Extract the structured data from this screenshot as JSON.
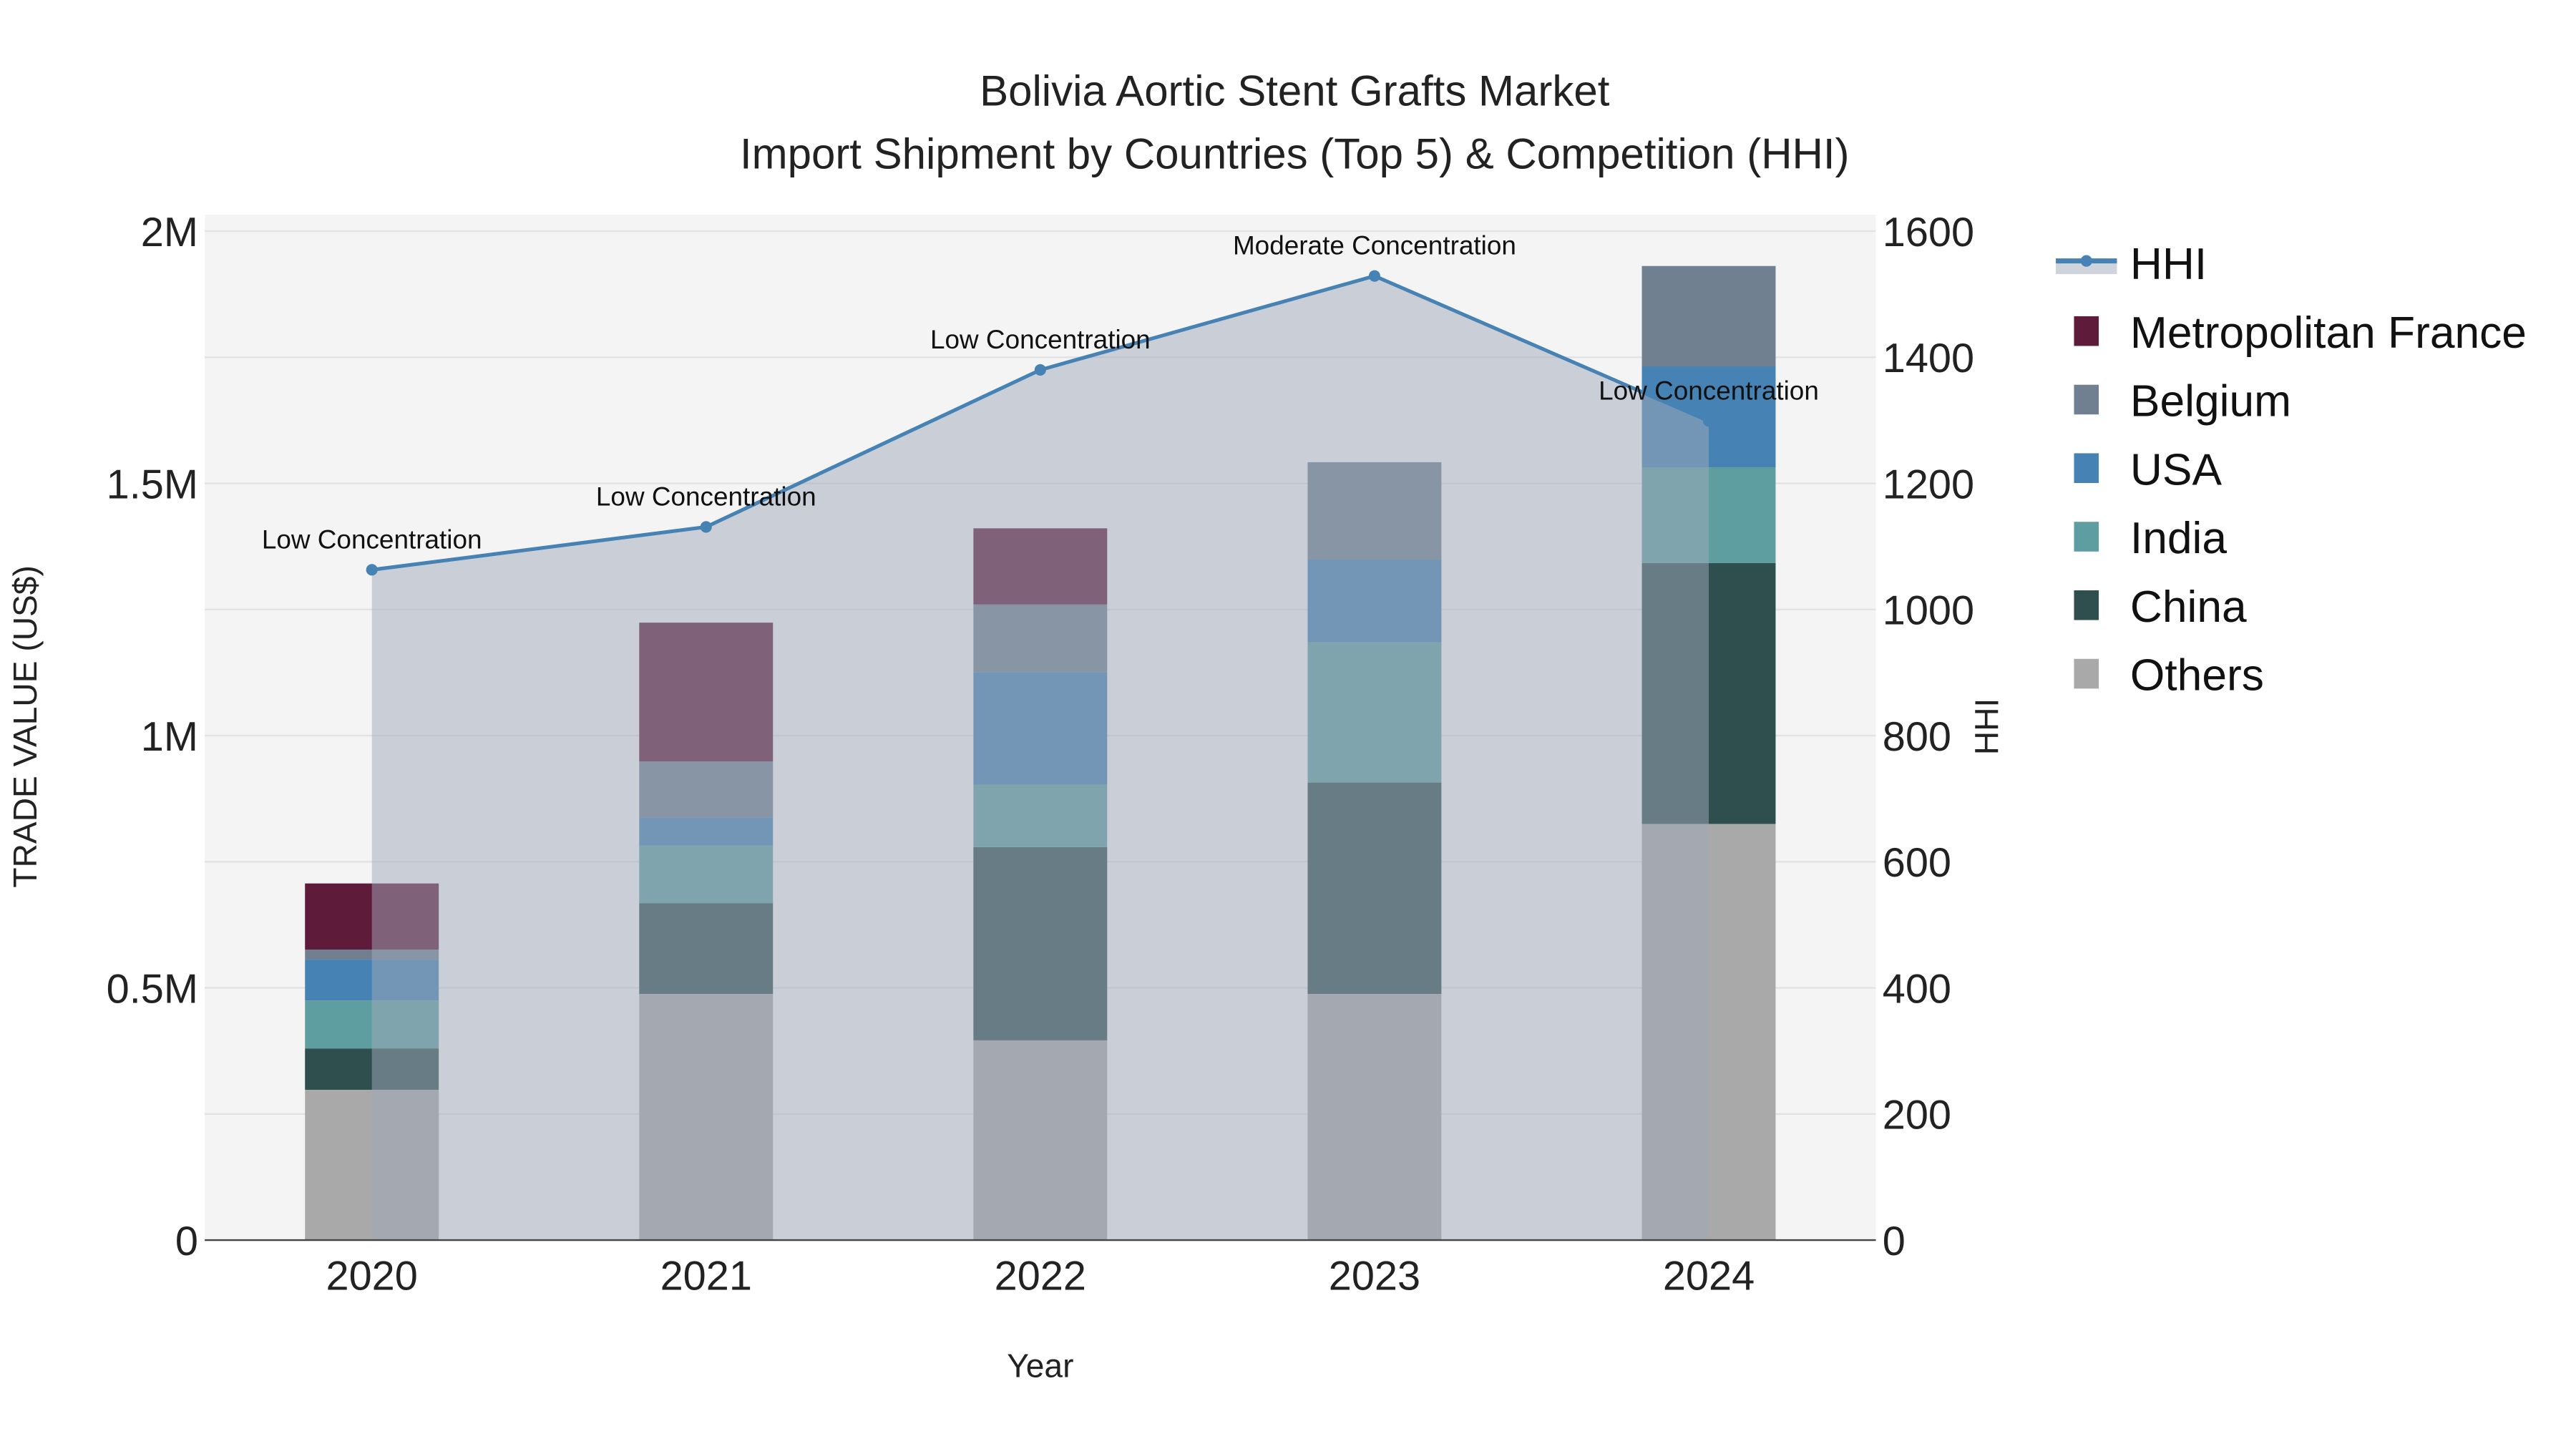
{
  "chart_data": {
    "type": "bar",
    "stacked": true,
    "title": "Bolivia Aortic Stent Grafts Market",
    "subtitle": "Import Shipment by Countries (Top 5) & Competition (HHI)",
    "xlabel": "Year",
    "ylabel": "TRADE VALUE (US$)",
    "y2label": "HHI",
    "categories": [
      "2020",
      "2021",
      "2022",
      "2023",
      "2024"
    ],
    "ylim": [
      0,
      2030000
    ],
    "y2lim": [
      0,
      1624
    ],
    "yticks": [
      {
        "v": 0,
        "label": "0"
      },
      {
        "v": 500000,
        "label": "0.5M"
      },
      {
        "v": 1000000,
        "label": "1M"
      },
      {
        "v": 1500000,
        "label": "1.5M"
      },
      {
        "v": 2000000,
        "label": "2M"
      }
    ],
    "y2ticks": [
      0,
      200,
      400,
      600,
      800,
      1000,
      1200,
      1400,
      1600
    ],
    "grid": true,
    "legend_placement": "right",
    "series": [
      {
        "name": "Others",
        "color": "#A9A9A9",
        "values": [
          298000,
          488000,
          396000,
          488000,
          825000
        ]
      },
      {
        "name": "China",
        "color": "#2F4F4F",
        "values": [
          82000,
          180000,
          383000,
          419000,
          517000
        ]
      },
      {
        "name": "India",
        "color": "#5F9EA0",
        "values": [
          95000,
          114000,
          124000,
          278000,
          190000
        ]
      },
      {
        "name": "USA",
        "color": "#4682B4",
        "values": [
          81000,
          56000,
          223000,
          164000,
          200000
        ]
      },
      {
        "name": "Belgium",
        "color": "#708090",
        "values": [
          20000,
          111000,
          134000,
          193000,
          199000
        ]
      },
      {
        "name": "Metropolitan France",
        "color": "#5E1B3A",
        "values": [
          131000,
          275000,
          151000,
          0,
          0
        ]
      }
    ],
    "hhi": {
      "name": "HHI",
      "color": "#4682B4",
      "values": [
        1063,
        1131,
        1380,
        1529,
        1299
      ],
      "annotations": [
        "Low Concentration",
        "Low Concentration",
        "Low Concentration",
        "Moderate Concentration",
        "Low Concentration"
      ]
    },
    "legend_order": [
      "HHI",
      "Metropolitan France",
      "Belgium",
      "USA",
      "India",
      "China",
      "Others"
    ]
  }
}
